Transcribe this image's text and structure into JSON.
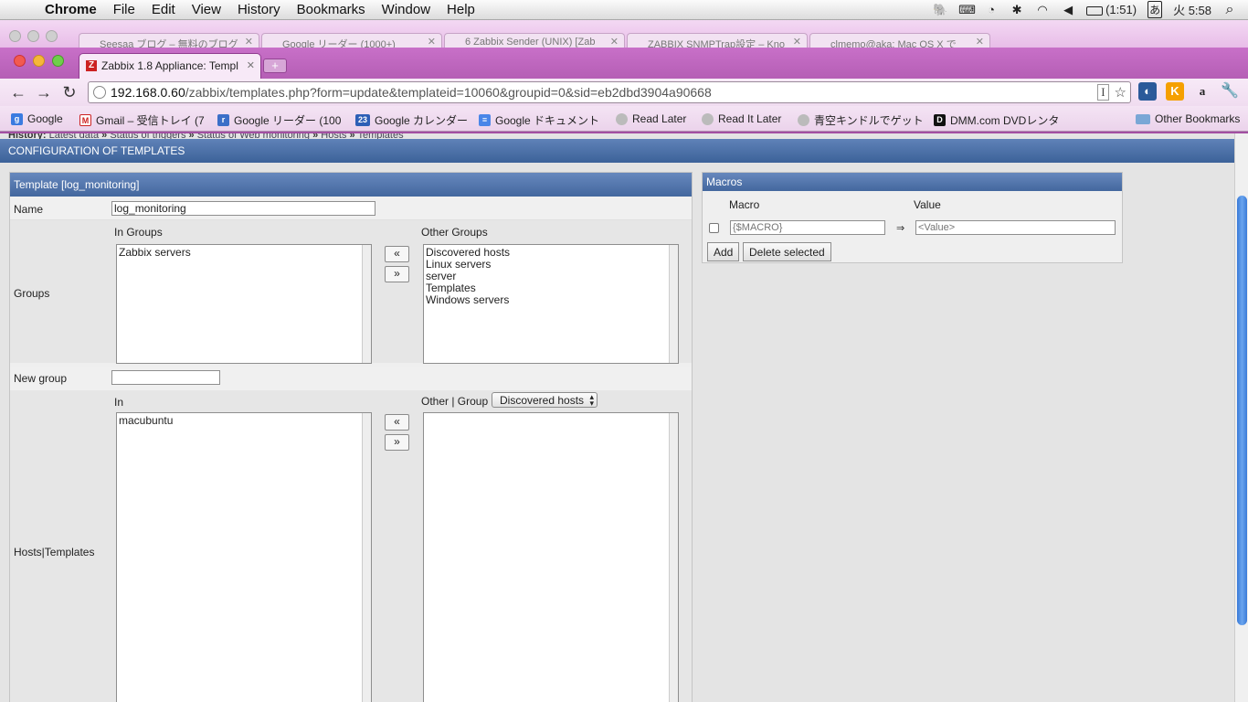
{
  "menubar": {
    "app_name": "Chrome",
    "items": [
      "File",
      "Edit",
      "View",
      "History",
      "Bookmarks",
      "Window",
      "Help"
    ],
    "battery": "(1:51)",
    "input_method": "あ",
    "clock": "火 5:58"
  },
  "back_tabs": [
    {
      "title": "Seesaa ブログ – 無料のブログ"
    },
    {
      "title": "Google リーダー (1000+)"
    },
    {
      "title": "6 Zabbix Sender (UNIX) [Zab"
    },
    {
      "title": "ZABBIX SNMPTrap設定 – Kno"
    },
    {
      "title": "clmemo@aka: Mac OS X で"
    }
  ],
  "active_tab": {
    "title": "Zabbix 1.8 Appliance: Templ",
    "favicon": "Z"
  },
  "address_bar": {
    "host": "192.168.0.60",
    "path": "/zabbix/templates.php?form=update&templateid=10060&groupid=0&sid=eb2dbd3904a90668"
  },
  "bookmarks": [
    {
      "label": "Google",
      "icon": "google-icon"
    },
    {
      "label": "Gmail – 受信トレイ (7",
      "icon": "gmail-icon"
    },
    {
      "label": "Google リーダー (100",
      "icon": "reader-icon"
    },
    {
      "label": "Google カレンダー",
      "icon": "calendar-icon",
      "badge": "23"
    },
    {
      "label": "Google ドキュメント",
      "icon": "docs-icon"
    },
    {
      "label": "Read Later",
      "icon": "globe-icon"
    },
    {
      "label": "Read It Later",
      "icon": "globe-icon"
    },
    {
      "label": "青空キンドルでゲット",
      "icon": "globe-icon"
    },
    {
      "label": "DMM.com DVDレンタ",
      "icon": "dmm-icon",
      "badge": "D"
    },
    {
      "label": "Other Bookmarks",
      "icon": "folder-icon"
    }
  ],
  "history": {
    "label": "History:",
    "items": [
      "Latest data",
      "Status of triggers",
      "Status of Web monitoring",
      "Hosts",
      "Templates"
    ],
    "sep": "»"
  },
  "page_title": "CONFIGURATION OF TEMPLATES",
  "template_form": {
    "header": "Template  [log_monitoring]",
    "name_label": "Name",
    "name_value": "log_monitoring",
    "groups_label": "Groups",
    "in_groups_label": "In Groups",
    "in_groups": [
      "Zabbix servers"
    ],
    "other_groups_label": "Other Groups",
    "other_groups": [
      "Discovered hosts",
      "Linux servers",
      "server",
      "Templates",
      "Windows servers"
    ],
    "move_left": "«",
    "move_right": "»",
    "new_group_label": "New group",
    "new_group_value": "",
    "hosts_label": "Hosts|Templates",
    "in_label": "In",
    "in_hosts": [
      "macubuntu"
    ],
    "other_label": "Other | Group",
    "group_select": "Discovered hosts",
    "other_hosts": []
  },
  "macros": {
    "header": "Macros",
    "macro_col": "Macro",
    "value_col": "Value",
    "macro_placeholder": "{$MACRO}",
    "value_placeholder": "<Value>",
    "arrow": "⇒",
    "add_label": "Add",
    "delete_label": "Delete selected"
  }
}
